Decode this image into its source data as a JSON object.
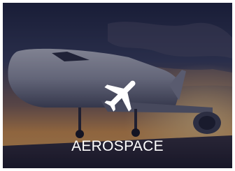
{
  "card": {
    "label": "AEROSPACE",
    "icon": "airplane-icon",
    "image": "airliner-at-sunset-photo"
  },
  "colors": {
    "overlay": "#12142c",
    "label_text": "#ffffff",
    "sunset": "#f0a048"
  }
}
